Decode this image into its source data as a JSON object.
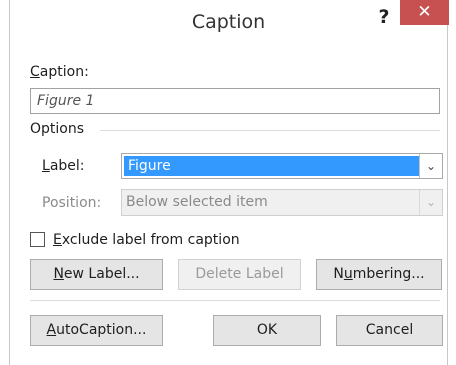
{
  "window": {
    "title": "Caption",
    "help_label": "?",
    "close_label": "✕"
  },
  "caption": {
    "label": "Caption:",
    "value": "Figure 1"
  },
  "options": {
    "group_label": "Options",
    "label_field": {
      "label": "Label:",
      "value": "Figure"
    },
    "position_field": {
      "label": "Position:",
      "value": "Below selected item",
      "disabled": true
    },
    "exclude_checkbox": {
      "label": "Exclude label from caption",
      "checked": false
    }
  },
  "buttons": {
    "new_label": "New Label...",
    "delete_label": "Delete Label",
    "numbering": "Numbering...",
    "autocaption": "AutoCaption...",
    "ok": "OK",
    "cancel": "Cancel"
  },
  "icons": {
    "dropdown": "chevron-down-icon",
    "close": "close-icon",
    "help": "help-icon"
  },
  "colors": {
    "close_button": "#c75050",
    "selection": "#3399ff"
  }
}
